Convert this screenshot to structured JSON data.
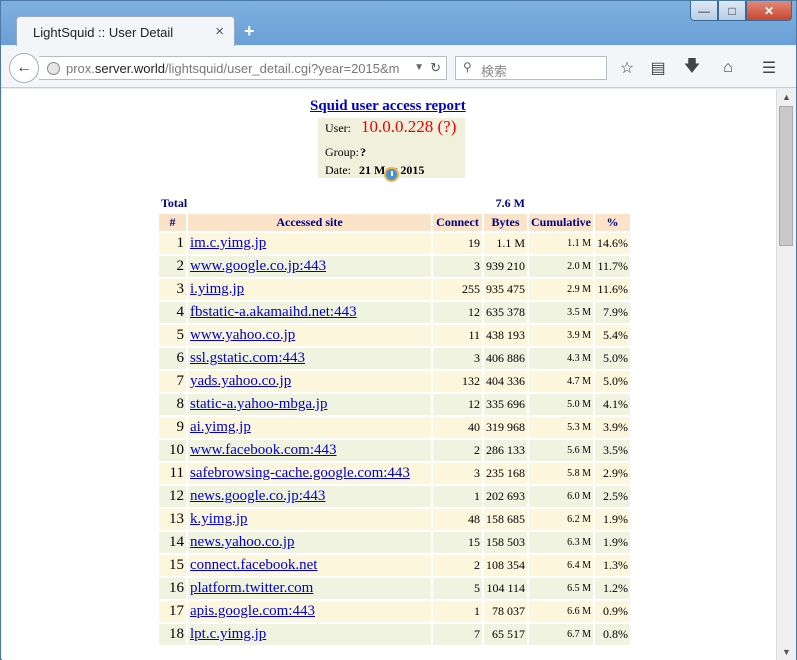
{
  "browser": {
    "tab_title": "LightSquid :: User Detail",
    "tab_close": "×",
    "new_tab": "+",
    "window_buttons": {
      "minimize": "—",
      "maximize": "□",
      "close": "✕"
    },
    "url_prefix": "prox.",
    "url_host": "server.world",
    "url_path": "/lightsquid/user_detail.cgi?year=2015&m",
    "search_placeholder": "検索"
  },
  "report": {
    "title": "Squid user access report",
    "user_label": "User:",
    "user_value": "10.0.0.228 (?)",
    "group_label": "Group:",
    "group_value": "?",
    "date_label": "Date:",
    "date_value": "21 May 2015",
    "total_label": "Total",
    "total_value": "7.6 M",
    "headers": {
      "num": "#",
      "site": "Accessed site",
      "connect": "Connect",
      "bytes": "Bytes",
      "cumulative": "Cumulative",
      "pct": "%"
    },
    "rows": [
      {
        "num": "1",
        "site": "im.c.yimg.jp",
        "connect": "19",
        "bytes": "1.1 M",
        "cumulative": "1.1 M",
        "pct": "14.6%"
      },
      {
        "num": "2",
        "site": "www.google.co.jp:443",
        "connect": "3",
        "bytes": "939 210",
        "cumulative": "2.0 M",
        "pct": "11.7%"
      },
      {
        "num": "3",
        "site": "i.yimg.jp",
        "connect": "255",
        "bytes": "935 475",
        "cumulative": "2.9 M",
        "pct": "11.6%"
      },
      {
        "num": "4",
        "site": "fbstatic-a.akamaihd.net:443",
        "connect": "12",
        "bytes": "635 378",
        "cumulative": "3.5 M",
        "pct": "7.9%"
      },
      {
        "num": "5",
        "site": "www.yahoo.co.jp",
        "connect": "11",
        "bytes": "438 193",
        "cumulative": "3.9 M",
        "pct": "5.4%"
      },
      {
        "num": "6",
        "site": "ssl.gstatic.com:443",
        "connect": "3",
        "bytes": "406 886",
        "cumulative": "4.3 M",
        "pct": "5.0%"
      },
      {
        "num": "7",
        "site": "yads.yahoo.co.jp",
        "connect": "132",
        "bytes": "404 336",
        "cumulative": "4.7 M",
        "pct": "5.0%"
      },
      {
        "num": "8",
        "site": "static-a.yahoo-mbga.jp",
        "connect": "12",
        "bytes": "335 696",
        "cumulative": "5.0 M",
        "pct": "4.1%"
      },
      {
        "num": "9",
        "site": "ai.yimg.jp",
        "connect": "40",
        "bytes": "319 968",
        "cumulative": "5.3 M",
        "pct": "3.9%"
      },
      {
        "num": "10",
        "site": "www.facebook.com:443",
        "connect": "2",
        "bytes": "286 133",
        "cumulative": "5.6 M",
        "pct": "3.5%"
      },
      {
        "num": "11",
        "site": "safebrowsing-cache.google.com:443",
        "connect": "3",
        "bytes": "235 168",
        "cumulative": "5.8 M",
        "pct": "2.9%"
      },
      {
        "num": "12",
        "site": "news.google.co.jp:443",
        "connect": "1",
        "bytes": "202 693",
        "cumulative": "6.0 M",
        "pct": "2.5%"
      },
      {
        "num": "13",
        "site": "k.yimg.jp",
        "connect": "48",
        "bytes": "158 685",
        "cumulative": "6.2 M",
        "pct": "1.9%"
      },
      {
        "num": "14",
        "site": "news.yahoo.co.jp",
        "connect": "15",
        "bytes": "158 503",
        "cumulative": "6.3 M",
        "pct": "1.9%"
      },
      {
        "num": "15",
        "site": "connect.facebook.net",
        "connect": "2",
        "bytes": "108 354",
        "cumulative": "6.4 M",
        "pct": "1.3%"
      },
      {
        "num": "16",
        "site": "platform.twitter.com",
        "connect": "5",
        "bytes": "104 114",
        "cumulative": "6.5 M",
        "pct": "1.2%"
      },
      {
        "num": "17",
        "site": "apis.google.com:443",
        "connect": "1",
        "bytes": "78 037",
        "cumulative": "6.6 M",
        "pct": "0.9%"
      },
      {
        "num": "18",
        "site": "lpt.c.yimg.jp",
        "connect": "7",
        "bytes": "65 517",
        "cumulative": "6.7 M",
        "pct": "0.8%"
      }
    ]
  }
}
